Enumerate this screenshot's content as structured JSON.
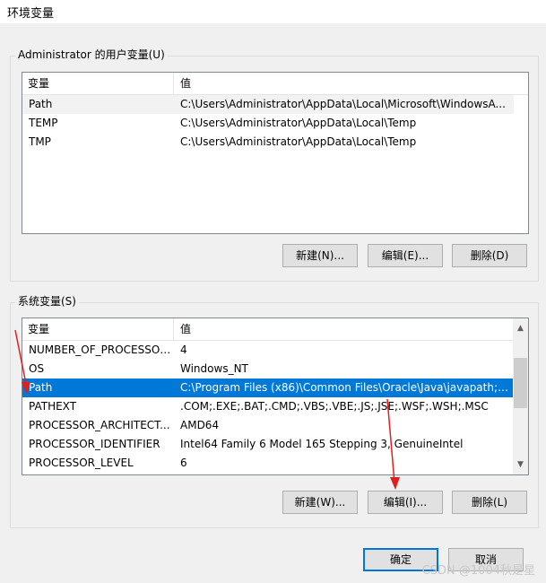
{
  "window": {
    "title": "环境变量"
  },
  "user_vars": {
    "group_label": "Administrator 的用户变量(U)",
    "columns": [
      "变量",
      "值"
    ],
    "rows": [
      {
        "name": "Path",
        "value": "C:\\Users\\Administrator\\AppData\\Local\\Microsoft\\WindowsA..."
      },
      {
        "name": "TEMP",
        "value": "C:\\Users\\Administrator\\AppData\\Local\\Temp"
      },
      {
        "name": "TMP",
        "value": "C:\\Users\\Administrator\\AppData\\Local\\Temp"
      }
    ],
    "buttons": {
      "new": "新建(N)...",
      "edit": "编辑(E)...",
      "delete": "删除(D)"
    }
  },
  "system_vars": {
    "group_label": "系统变量(S)",
    "columns": [
      "变量",
      "值"
    ],
    "rows": [
      {
        "name": "NUMBER_OF_PROCESSORS",
        "value": "4"
      },
      {
        "name": "OS",
        "value": "Windows_NT"
      },
      {
        "name": "Path",
        "value": "C:\\Program Files (x86)\\Common Files\\Oracle\\Java\\javapath;C:..."
      },
      {
        "name": "PATHEXT",
        "value": ".COM;.EXE;.BAT;.CMD;.VBS;.VBE;.JS;.JSE;.WSF;.WSH;.MSC"
      },
      {
        "name": "PROCESSOR_ARCHITECT...",
        "value": "AMD64"
      },
      {
        "name": "PROCESSOR_IDENTIFIER",
        "value": "Intel64 Family 6 Model 165 Stepping 3, GenuineIntel"
      },
      {
        "name": "PROCESSOR_LEVEL",
        "value": "6"
      }
    ],
    "buttons": {
      "new": "新建(W)...",
      "edit": "编辑(I)...",
      "delete": "删除(L)"
    }
  },
  "footer": {
    "ok": "确定",
    "cancel": "取消"
  },
  "watermark": "CSDN @1004秋是星",
  "colors": {
    "selection": "#0078d7",
    "annotation": "#e02020"
  }
}
